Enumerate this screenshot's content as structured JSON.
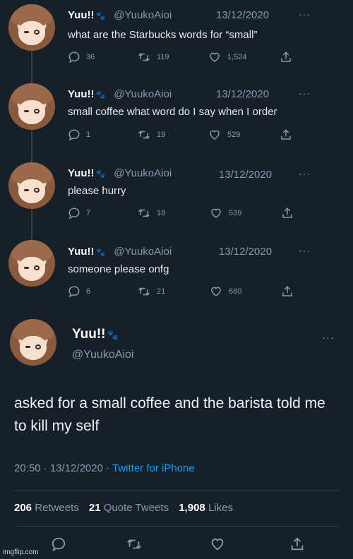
{
  "thread": [
    {
      "name": "Yuu!!",
      "handle": "@YuukoAioi",
      "date": "13/12/2020",
      "more": "···",
      "text": "what are the Starbucks words for “small”",
      "replies": "36",
      "retweets": "119",
      "likes": "1,524"
    },
    {
      "name": "Yuu!!",
      "handle": "@YuukoAioi",
      "date": "13/12/2020",
      "more": "···",
      "text": "small coffee what word do I say when I order",
      "replies": "1",
      "retweets": "19",
      "likes": "529"
    },
    {
      "name": "Yuu!!",
      "handle": "@YuukoAioi",
      "date": "13/12/2020",
      "more": "···",
      "text": "please hurry",
      "replies": "7",
      "retweets": "18",
      "likes": "539"
    },
    {
      "name": "Yuu!!",
      "handle": "@YuukoAioi",
      "date": "13/12/2020",
      "more": "···",
      "text": "someone please onfg",
      "replies": "6",
      "retweets": "21",
      "likes": "680"
    }
  ],
  "main": {
    "name": "Yuu!!",
    "handle": "@YuukoAioi",
    "more": "···",
    "text": "asked for a small coffee and the barista told me to kill my self",
    "time": "20:50 · 13/12/2020 · ",
    "source": "Twitter for iPhone",
    "retweets_count": "206",
    "retweets_label": "Retweets",
    "quotes_count": "21",
    "quotes_label": "Quote Tweets",
    "likes_count": "1,908",
    "likes_label": "Likes"
  },
  "icons": {
    "reply": "reply-icon",
    "retweet": "retweet-icon",
    "like": "heart-icon",
    "share": "share-icon",
    "paw": "paw-icon"
  },
  "colors": {
    "background": "#15202b",
    "muted": "#8b98a5",
    "link": "#1d9bf0",
    "divider": "#38444d"
  },
  "watermark": "imgflip.com"
}
